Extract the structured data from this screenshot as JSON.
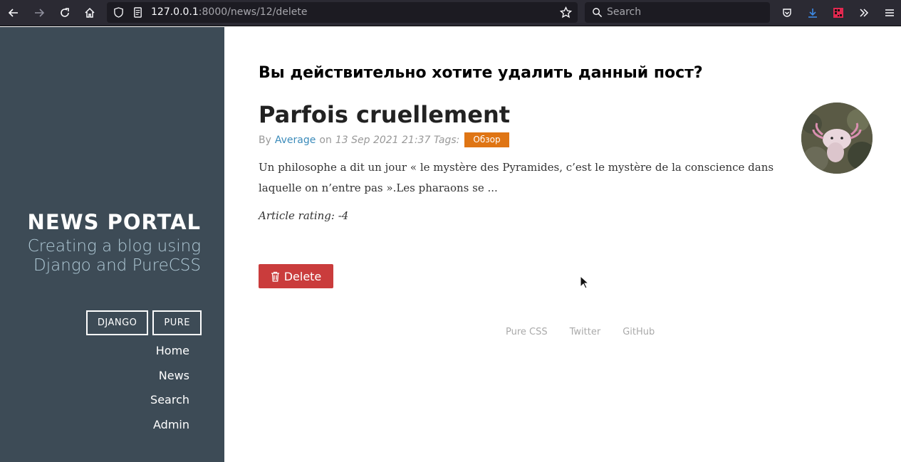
{
  "browser": {
    "url_host": "127.0.0.1",
    "url_path": ":8000/news/12/delete",
    "search_placeholder": "Search"
  },
  "sidebar": {
    "brand_title": "NEWS PORTAL",
    "brand_tagline": "Creating a blog using Django and PureCSS",
    "buttons": [
      "DJANGO",
      "PURE"
    ],
    "nav": [
      "Home",
      "News",
      "Search",
      "Admin"
    ]
  },
  "main": {
    "confirm_title": "Вы действительно хотите удалить данный пост?",
    "post_title": "Parfois cruellement",
    "meta_by": "By",
    "author": "Average",
    "meta_on": "on",
    "date": "13 Sep 2021 21:37 Tags:",
    "tag": "Обзор",
    "excerpt": "Un philosophe a dit un jour « le mystère des Pyramides, c’est le mystère de la conscience dans laquelle on n’entre pas ».Les pharaons se ...",
    "rating": "Article rating: -4",
    "delete_label": "Delete"
  },
  "footer": {
    "links": [
      "Pure CSS",
      "Twitter",
      "GitHub"
    ]
  },
  "colors": {
    "sidebar_bg": "#3d4b56",
    "author_link": "#3b8bba",
    "tag_bg": "#df7514",
    "delete_bg": "#ca3c3c"
  }
}
